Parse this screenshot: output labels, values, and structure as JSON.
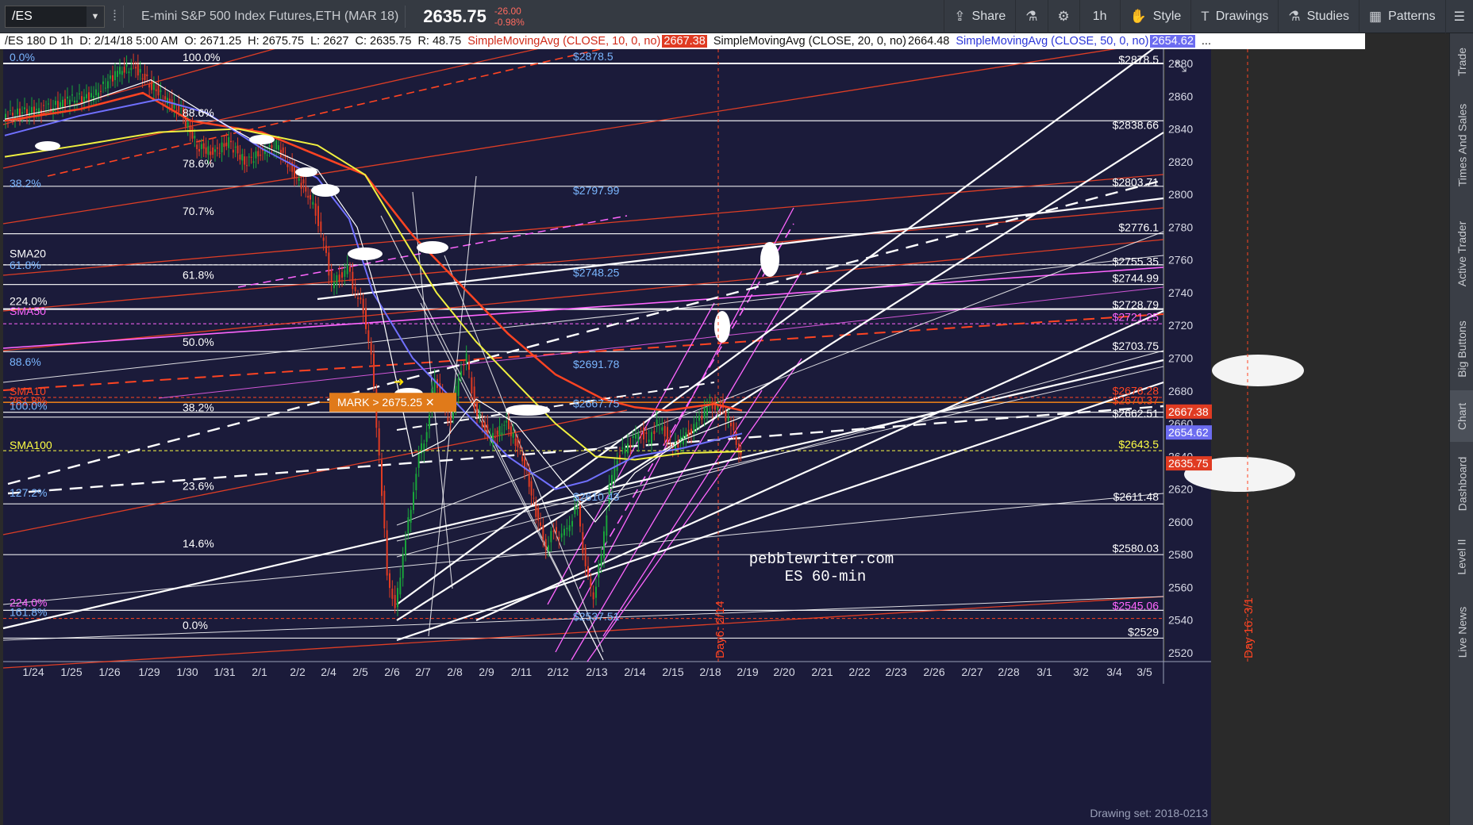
{
  "toolbar": {
    "symbol": "/ES",
    "instrument": "E-mini S&P 500 Index Futures,ETH (MAR 18)",
    "last_price": "2635.75",
    "change": "-26.00",
    "change_pct": "-0.98%",
    "share_label": "Share",
    "interval_label": "1h",
    "style_label": "Style",
    "drawings_label": "Drawings",
    "studies_label": "Studies",
    "patterns_label": "Patterns"
  },
  "infobar": {
    "spec": "/ES 180 D 1h",
    "date": "D: 2/14/18 5:00 AM",
    "open": "O: 2671.25",
    "high": "H: 2675.75",
    "low": "L: 2627",
    "close": "C: 2635.75",
    "range": "R: 48.75",
    "sma10_label": "SimpleMovingAvg (CLOSE, 10, 0, no)",
    "sma10_value": "2667.38",
    "sma20_label": "SimpleMovingAvg (CLOSE, 20, 0, no)",
    "sma20_value": "2664.48",
    "sma50_label": "SimpleMovingAvg (CLOSE, 50, 0, no)",
    "sma50_value": "2654.62",
    "more": "..."
  },
  "side_tabs": [
    "Trade",
    "Times And Sales",
    "Active Trader",
    "Big Buttons",
    "Chart",
    "Dashboard",
    "Level II",
    "Live News"
  ],
  "active_side_tab": "Chart",
  "chart": {
    "watermark_line1": "pebblewriter.com",
    "watermark_line2": "ES 60-min",
    "mark_label": "MARK > 2675.25",
    "drawing_set": "Drawing set: 2018-0213",
    "day_label_1": "Day6: 2/14",
    "day_label_2": "Day 16: 3/1",
    "price_labels": [
      {
        "text": "2880",
        "price": 2880
      },
      {
        "text": "2860",
        "price": 2860
      },
      {
        "text": "2840",
        "price": 2840
      },
      {
        "text": "2820",
        "price": 2820
      },
      {
        "text": "2800",
        "price": 2800
      },
      {
        "text": "2780",
        "price": 2780
      },
      {
        "text": "2760",
        "price": 2760
      },
      {
        "text": "2740",
        "price": 2740
      },
      {
        "text": "2720",
        "price": 2720
      },
      {
        "text": "2700",
        "price": 2700
      },
      {
        "text": "2680",
        "price": 2680
      },
      {
        "text": "2660",
        "price": 2660
      },
      {
        "text": "2640",
        "price": 2640
      },
      {
        "text": "2620",
        "price": 2620
      },
      {
        "text": "2600",
        "price": 2600
      },
      {
        "text": "2580",
        "price": 2580
      },
      {
        "text": "2560",
        "price": 2560
      },
      {
        "text": "2540",
        "price": 2540
      },
      {
        "text": "2520",
        "price": 2520
      }
    ],
    "axis_badges": [
      {
        "text": "2667.38",
        "price": 2667.38,
        "color": "#e03b22"
      },
      {
        "text": "2654.62",
        "price": 2654.62,
        "color": "#6c6cf0"
      },
      {
        "text": "2635.75",
        "price": 2635.75,
        "color": "#e03b22"
      }
    ],
    "x_labels": [
      "1/24",
      "1/25",
      "1/26",
      "1/29",
      "1/30",
      "1/31",
      "2/1",
      "2/2",
      "2/4",
      "2/5",
      "2/6",
      "2/7",
      "2/8",
      "2/9",
      "2/11",
      "2/12",
      "2/13",
      "2/14",
      "2/15",
      "2/18",
      "2/19",
      "2/20",
      "2/21",
      "2/22",
      "2/23",
      "2/26",
      "2/27",
      "2/28",
      "3/1",
      "3/2",
      "3/4",
      "3/5"
    ],
    "level_labels": [
      {
        "text": "$2878.5",
        "price": 2878.5,
        "color": "#ffffff"
      },
      {
        "text": "$2838.66",
        "price": 2838.66,
        "color": "#ffffff"
      },
      {
        "text": "$2803.71",
        "price": 2803.71,
        "color": "#ffffff"
      },
      {
        "text": "$2776.1",
        "price": 2776.1,
        "color": "#ffffff"
      },
      {
        "text": "$2755.35",
        "price": 2755.35,
        "color": "#ffffff"
      },
      {
        "text": "$2744.99",
        "price": 2744.99,
        "color": "#ffffff"
      },
      {
        "text": "$2728.79",
        "price": 2728.79,
        "color": "#ffffff"
      },
      {
        "text": "$2721.25",
        "price": 2721.25,
        "color": "#ff66ff"
      },
      {
        "text": "$2703.75",
        "price": 2703.75,
        "color": "#ffffff"
      },
      {
        "text": "$2676.28",
        "price": 2676.28,
        "color": "#ff4422"
      },
      {
        "text": "$2670.37",
        "price": 2670.37,
        "color": "#ff4422"
      },
      {
        "text": "$2662.51",
        "price": 2662.51,
        "color": "#ffffff"
      },
      {
        "text": "$2643.5",
        "price": 2643.5,
        "color": "#ffff44"
      },
      {
        "text": "$2611.48",
        "price": 2611.48,
        "color": "#ffffff"
      },
      {
        "text": "$2580.03",
        "price": 2580.03,
        "color": "#ffffff"
      },
      {
        "text": "$2545.06",
        "price": 2545.06,
        "color": "#ff66ff"
      },
      {
        "text": "$2529",
        "price": 2529,
        "color": "#ffffff"
      }
    ],
    "fib_left": [
      {
        "text": "0.0%",
        "price": 2880,
        "color": "#7ab6ff"
      },
      {
        "text": "38.2%",
        "price": 2803,
        "color": "#7ab6ff"
      },
      {
        "text": "SMA20",
        "price": 2760,
        "color": "#ffffff"
      },
      {
        "text": "61.8%",
        "price": 2753,
        "color": "#7ab6ff"
      },
      {
        "text": "224.0%",
        "price": 2731,
        "color": "#ffffff"
      },
      {
        "text": "SMA50",
        "price": 2725,
        "color": "#ff66ff"
      },
      {
        "text": "88.6%",
        "price": 2694,
        "color": "#7ab6ff"
      },
      {
        "text": "SMA10",
        "price": 2676,
        "color": "#ff4422"
      },
      {
        "text": "261.8%",
        "price": 2670,
        "color": "#ff4422"
      },
      {
        "text": "100.0%",
        "price": 2667,
        "color": "#7ab6ff"
      },
      {
        "text": "SMA100",
        "price": 2643,
        "color": "#ffff44"
      },
      {
        "text": "127.2%",
        "price": 2614,
        "color": "#7ab6ff"
      },
      {
        "text": "224.0%",
        "price": 2547,
        "color": "#ff66ff"
      },
      {
        "text": "161.8%",
        "price": 2541,
        "color": "#7ab6ff"
      }
    ],
    "fib_mid": [
      {
        "text": "100.0%",
        "price": 2880
      },
      {
        "text": "88.6%",
        "price": 2846
      },
      {
        "text": "78.6%",
        "price": 2815
      },
      {
        "text": "70.7%",
        "price": 2786
      },
      {
        "text": "61.8%",
        "price": 2747
      },
      {
        "text": "50.0%",
        "price": 2706
      },
      {
        "text": "38.2%",
        "price": 2666
      },
      {
        "text": "23.6%",
        "price": 2618
      },
      {
        "text": "14.6%",
        "price": 2583
      },
      {
        "text": "0.0%",
        "price": 2533
      }
    ],
    "fib_center": [
      {
        "text": "$2878.5",
        "price": 2880
      },
      {
        "text": "$2797.99",
        "price": 2798
      },
      {
        "text": "$2748.25",
        "price": 2748
      },
      {
        "text": "$2691.78",
        "price": 2692
      },
      {
        "text": "$2667.75",
        "price": 2668
      },
      {
        "text": "$2610.43",
        "price": 2611
      },
      {
        "text": "$2537.51",
        "price": 2538
      }
    ]
  },
  "colors": {
    "chart_bg": "#1b1b3a",
    "up_candle": "#19a53a",
    "down_candle": "#e03b22",
    "sma10": "#ff4422",
    "sma20": "#ffffff",
    "sma50": "#7070ff",
    "sma100": "#f0f040",
    "fib": "#ffffff",
    "channel_magenta": "#ff66ff",
    "mark": "#e07a1a"
  }
}
